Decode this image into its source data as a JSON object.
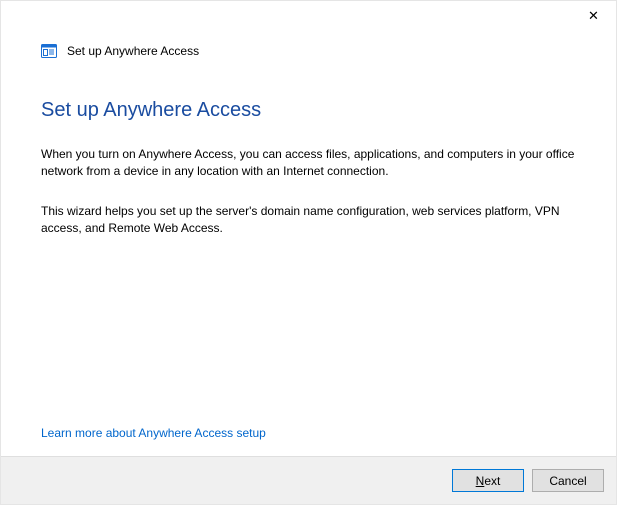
{
  "titlebar": {
    "close_label": "✕"
  },
  "header": {
    "title": "Set up Anywhere Access"
  },
  "content": {
    "heading": "Set up Anywhere Access",
    "paragraph1": "When you turn on Anywhere Access, you can access files, applications, and computers in your office network from a device in any location with an Internet connection.",
    "paragraph2": "This wizard helps you set up the server's domain name configuration, web services platform, VPN access, and Remote Web Access.",
    "learn_more": "Learn more about Anywhere Access setup"
  },
  "footer": {
    "next_key": "N",
    "next_rest": "ext",
    "cancel": "Cancel"
  }
}
